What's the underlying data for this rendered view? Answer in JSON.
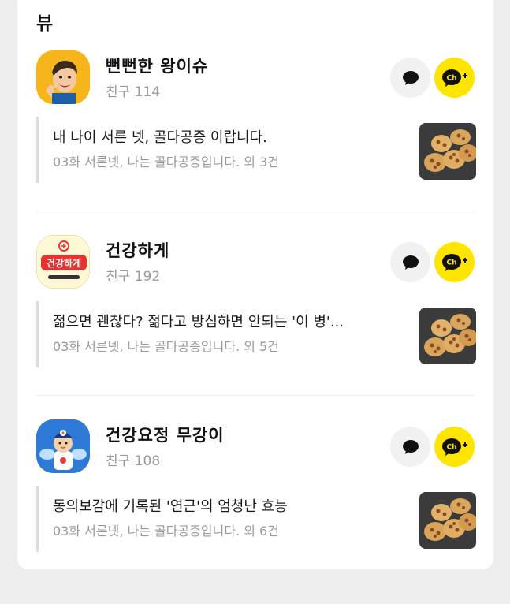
{
  "section_title": "뷰",
  "channels": [
    {
      "name": "뻔뻔한 왕이슈",
      "friends": "친구 114",
      "avatar_icon": "person-face-avatar",
      "post": {
        "title": "내 나이 서른 넷, 골다공증 이랍니다.",
        "subtitle": "03화 서른넷, 나는 골다공증입니다. 외 3건",
        "thumbnail_icon": "lotus-root-food-photo"
      }
    },
    {
      "name": "건강하게",
      "friends": "친구 192",
      "avatar_icon": "health-logo-avatar",
      "avatar_text": "건강하게",
      "post": {
        "title": "젊으면 괜찮다? 젊다고 방심하면 안되는 '이 병'...",
        "subtitle": "03화 서른넷, 나는 골다공증입니다. 외 5건",
        "thumbnail_icon": "lotus-root-food-photo"
      }
    },
    {
      "name": "건강요정 무강이",
      "friends": "친구 108",
      "avatar_icon": "doctor-character-avatar",
      "post": {
        "title": "동의보감에 기록된 '연근'의 엄청난 효능",
        "subtitle": "03화 서른넷, 나는 골다공증입니다. 외 6건",
        "thumbnail_icon": "lotus-root-food-photo"
      }
    }
  ],
  "colors": {
    "kakao_yellow": "#fee500",
    "chat_button_bg": "#f1f1f1",
    "sub_text": "#9a9a9a"
  },
  "buttons": {
    "chat_icon": "chat-bubble-icon",
    "channel_add_icon": "channel-add-icon",
    "channel_add_label": "Ch"
  }
}
